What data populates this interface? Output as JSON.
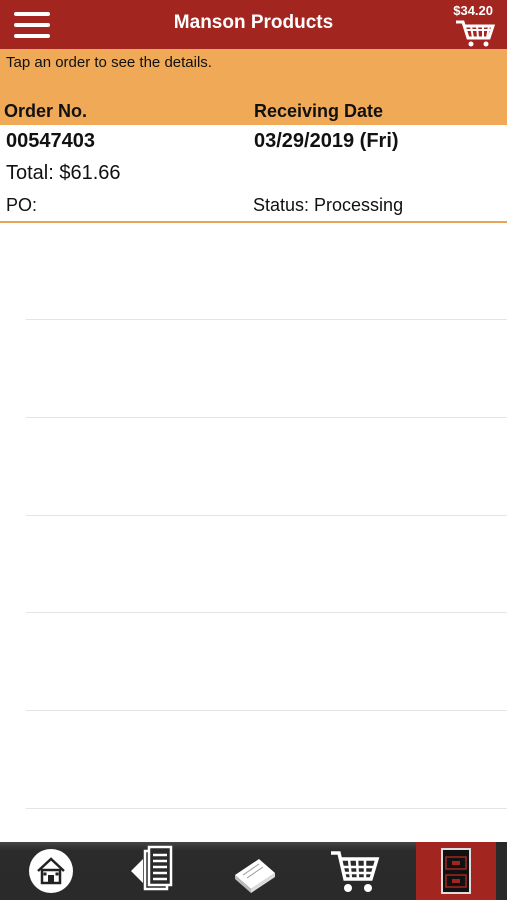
{
  "header": {
    "title": "Manson Products",
    "cart_total": "$34.20",
    "menu_icon": "hamburger-menu-icon",
    "cart_icon": "shopping-cart-icon",
    "bar_color": "#a3251f"
  },
  "info": {
    "message": "Tap an order to see the details.",
    "col_order": "Order No.",
    "col_date": "Receiving Date",
    "bar_color": "#f0a957"
  },
  "orders": [
    {
      "order_no": "00547403",
      "receiving_date": "03/29/2019 (Fri)",
      "total": "Total: $61.66",
      "po": "PO:",
      "status": "Status: Processing"
    }
  ],
  "tabbar": {
    "tabs": [
      {
        "name": "home",
        "icon": "home-icon"
      },
      {
        "name": "order-history",
        "icon": "order-history-icon"
      },
      {
        "name": "catalog",
        "icon": "catalog-book-icon"
      },
      {
        "name": "cart",
        "icon": "shopping-cart-icon"
      },
      {
        "name": "orders",
        "icon": "orders-icon",
        "active": true
      }
    ],
    "active_color": "#a3251f"
  }
}
